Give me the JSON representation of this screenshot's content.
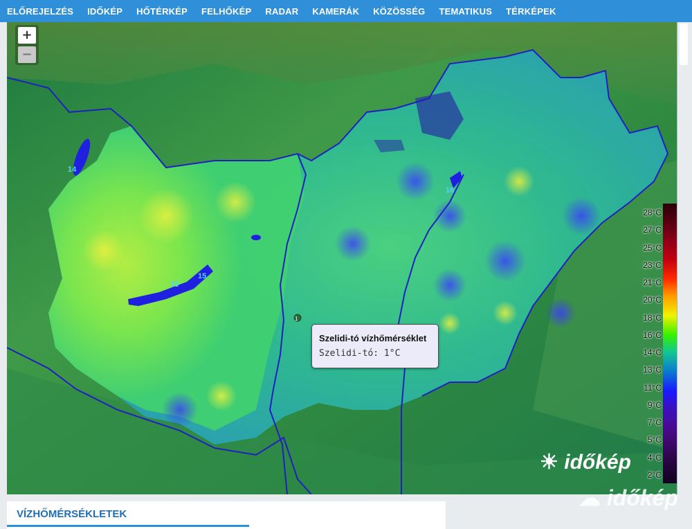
{
  "nav": {
    "items": [
      "ELŐREJELZÉS",
      "IDŐKÉP",
      "HŐTÉRKÉP",
      "FELHŐKÉP",
      "RADAR",
      "KAMERÁK",
      "KÖZÖSSÉG",
      "TEMATIKUS",
      "TÉRKÉPEK"
    ]
  },
  "map": {
    "zoom_in": "+",
    "zoom_out": "−",
    "tooltip": {
      "title": "Szelidi-tó vízhőmérséklet",
      "body": "Szelidi-tó: 1°C"
    },
    "lake_labels": [
      "14",
      "15",
      "15",
      "16"
    ],
    "marker_label": "1",
    "logo_text": "időkép",
    "logo_text_2": "időkép"
  },
  "legend": {
    "labels": [
      "28°C",
      "27°C",
      "25°C",
      "23°C",
      "21°C",
      "20°C",
      "18°C",
      "16°C",
      "14°C",
      "13°C",
      "11°C",
      "9°C",
      "7°C",
      "5°C",
      "4°C",
      "2°C"
    ],
    "colors": [
      "#2a0008",
      "#5a0010",
      "#8a0018",
      "#c20010",
      "#ff2a00",
      "#ff9a00",
      "#f2f200",
      "#36f000",
      "#12c890",
      "#0a7ad0",
      "#1a1aff",
      "#3a10c0",
      "#4a0a90",
      "#3a0860",
      "#25053e",
      "#120020"
    ]
  },
  "panel": {
    "title": "VÍZHŐMÉRSÉKLETEK"
  }
}
